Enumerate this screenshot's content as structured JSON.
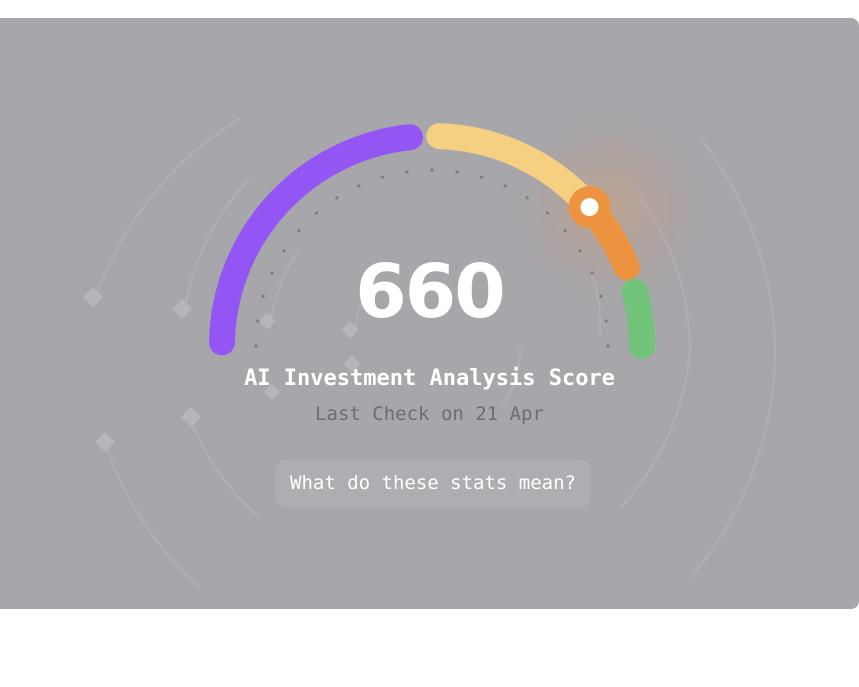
{
  "score_card": {
    "score": "660",
    "title": "AI Investment Analysis Score",
    "subtitle": "Last Check on 21 Apr",
    "help_button_label": "What do these stats mean?"
  },
  "gauge": {
    "segments": [
      {
        "name": "purple",
        "color": "#9356f5"
      },
      {
        "name": "yellow",
        "color": "#f5d080"
      },
      {
        "name": "orange",
        "color": "#ee9440"
      },
      {
        "name": "green",
        "color": "#72c37a"
      }
    ],
    "indicator_color": "#ffffff",
    "indicator_level_fraction": 0.77
  },
  "colors": {
    "card_background": "#a7a6ab",
    "page_background": "#ffffff"
  }
}
